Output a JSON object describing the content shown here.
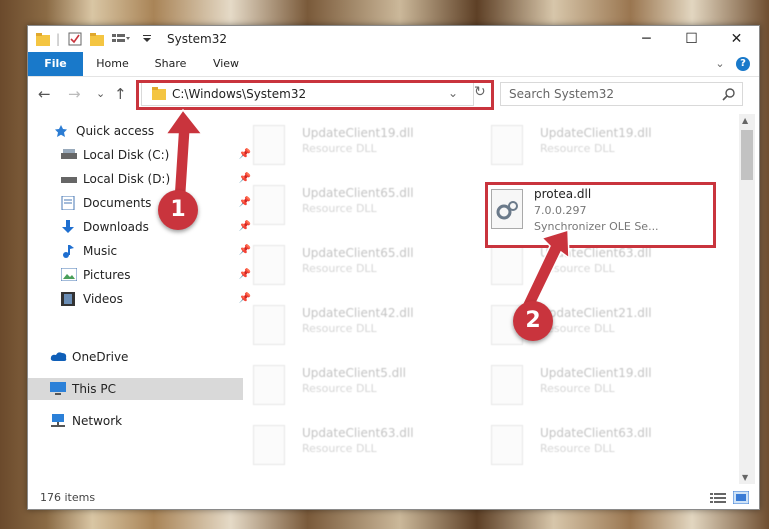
{
  "window": {
    "title": "System32",
    "minimize": "─",
    "maximize": "☐",
    "close": "✕"
  },
  "ribbon": {
    "tabs": [
      "File",
      "Home",
      "Share",
      "View"
    ],
    "collapse": "⌄",
    "help": "?"
  },
  "address": {
    "path": "C:\\Windows\\System32",
    "dropdown": "⌄",
    "refresh": "↻"
  },
  "search": {
    "placeholder": "Search System32"
  },
  "nav": {
    "back": "←",
    "forward": "→",
    "recent": "⌄",
    "up": "↑"
  },
  "sidebar": {
    "items": [
      {
        "label": "Quick access",
        "icon": "star-icon",
        "pinned": false
      },
      {
        "label": "Local Disk (C:)",
        "icon": "drive-icon",
        "pinned": true
      },
      {
        "label": "Local Disk (D:)",
        "icon": "drive-icon",
        "pinned": true
      },
      {
        "label": "Documents",
        "icon": "documents-icon",
        "pinned": true
      },
      {
        "label": "Downloads",
        "icon": "download-icon",
        "pinned": true
      },
      {
        "label": "Music",
        "icon": "music-icon",
        "pinned": true
      },
      {
        "label": "Pictures",
        "icon": "pictures-icon",
        "pinned": true
      },
      {
        "label": "Videos",
        "icon": "videos-icon",
        "pinned": true
      },
      {
        "label": "OneDrive",
        "icon": "cloud-icon",
        "pinned": false
      },
      {
        "label": "This PC",
        "icon": "computer-icon",
        "pinned": false
      },
      {
        "label": "Network",
        "icon": "network-icon",
        "pinned": false
      }
    ]
  },
  "files": [
    {
      "name": "UpdateClient19.dll",
      "sub": "Resource DLL"
    },
    {
      "name": "UpdateClient19.dll",
      "sub": "Resource DLL"
    },
    {
      "name": "UpdateClient65.dll",
      "sub": "Resource DLL"
    },
    {
      "name": "UpdateClient65.dll",
      "sub": "Resource DLL"
    },
    {
      "name": "UpdateClient63.dll",
      "sub": "Resource DLL"
    },
    {
      "name": "UpdateClient42.dll",
      "sub": "Resource DLL"
    },
    {
      "name": "UpdateClient21.dll",
      "sub": "Resource DLL"
    },
    {
      "name": "UpdateClient5.dll",
      "sub": "Resource DLL"
    },
    {
      "name": "UpdateClient19.dll",
      "sub": "Resource DLL"
    },
    {
      "name": "UpdateClient63.dll",
      "sub": "Resource DLL"
    },
    {
      "name": "UpdateClient63.dll",
      "sub": "Resource DLL"
    }
  ],
  "highlighted_file": {
    "name": "protea.dll",
    "version": "7.0.0.297",
    "description": "Synchronizer OLE Se..."
  },
  "status": {
    "count": "176 items"
  },
  "annotations": {
    "badge1": "1",
    "badge2": "2"
  },
  "colors": {
    "accent": "#1979ca",
    "highlight": "#c9343d"
  }
}
